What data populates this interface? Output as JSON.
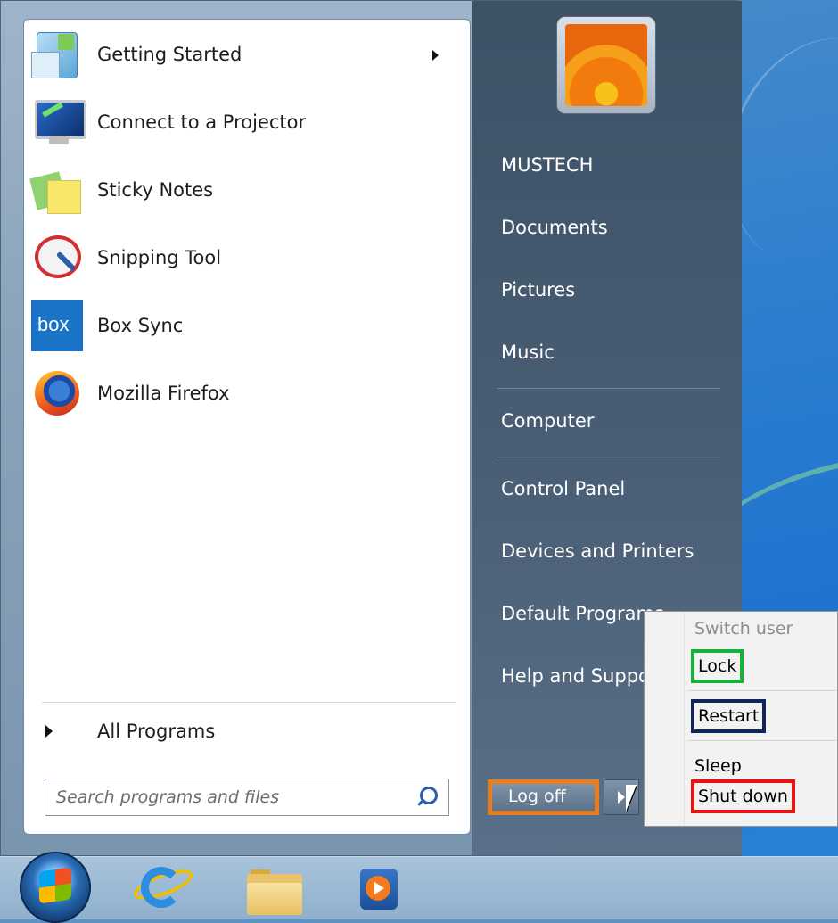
{
  "start_menu": {
    "programs": [
      {
        "label": "Getting Started",
        "icon": "getting-started-icon",
        "has_submenu": true
      },
      {
        "label": "Connect to a Projector",
        "icon": "projector-icon"
      },
      {
        "label": "Sticky Notes",
        "icon": "sticky-notes-icon"
      },
      {
        "label": "Snipping Tool",
        "icon": "snipping-tool-icon"
      },
      {
        "label": "Box Sync",
        "icon": "box-sync-icon",
        "icon_text": "box"
      },
      {
        "label": "Mozilla Firefox",
        "icon": "firefox-icon"
      }
    ],
    "all_programs_label": "All Programs",
    "search": {
      "placeholder": "Search programs and files"
    },
    "right_items": {
      "user": "MUSTECH",
      "documents": "Documents",
      "pictures": "Pictures",
      "music": "Music",
      "computer": "Computer",
      "control_panel": "Control Panel",
      "devices": "Devices and Printers",
      "default_programs": "Default Programs",
      "help": "Help and Support"
    },
    "logoff_label": "Log off"
  },
  "power_menu": {
    "items": [
      {
        "label": "Switch user",
        "disabled": true
      },
      {
        "label": "Lock",
        "highlight_color": "#16b03a"
      },
      {
        "label": "Restart",
        "highlight_color": "#0e2658"
      },
      {
        "label": "Sleep"
      },
      {
        "label": "Shut down",
        "highlight_color": "#ee1111"
      }
    ]
  },
  "annotations": {
    "logoff_box_color": "#e67e22"
  },
  "taskbar": {
    "items": [
      "start-orb-icon",
      "internet-explorer-icon",
      "file-explorer-icon",
      "media-player-icon"
    ]
  }
}
